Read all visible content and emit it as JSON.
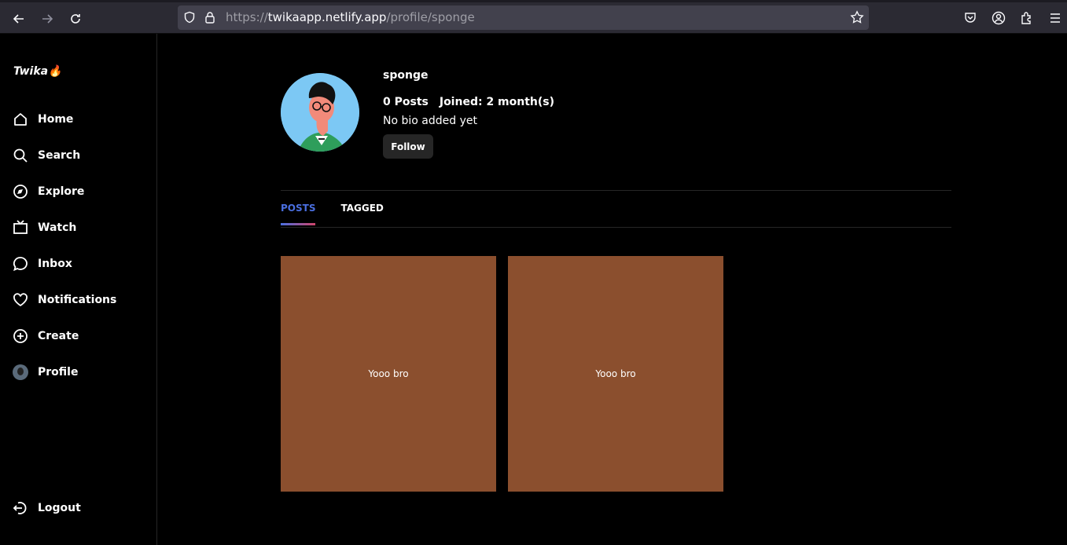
{
  "browser": {
    "url_protocol": "https://",
    "url_domain": "twikaapp.netlify.app",
    "url_path": "/profile/sponge"
  },
  "sidebar": {
    "logo": "Twika🔥",
    "items": [
      {
        "label": "Home",
        "icon": "home-icon"
      },
      {
        "label": "Search",
        "icon": "search-icon"
      },
      {
        "label": "Explore",
        "icon": "compass-icon"
      },
      {
        "label": "Watch",
        "icon": "tv-icon"
      },
      {
        "label": "Inbox",
        "icon": "chat-icon"
      },
      {
        "label": "Notifications",
        "icon": "heart-icon"
      },
      {
        "label": "Create",
        "icon": "plus-circle-icon"
      },
      {
        "label": "Profile",
        "icon": "avatar"
      }
    ],
    "logout": "Logout"
  },
  "profile": {
    "username": "sponge",
    "posts_count": "0 Posts",
    "joined": "Joined: 2 month(s)",
    "bio": "No bio added yet",
    "follow_label": "Follow"
  },
  "tabs": [
    {
      "label": "POSTS",
      "active": true
    },
    {
      "label": "TAGGED",
      "active": false
    }
  ],
  "posts": [
    {
      "text": "Yooo bro",
      "color": "#8b4f2e"
    },
    {
      "text": "Yooo bro",
      "color": "#8b4f2e"
    }
  ],
  "colors": {
    "accent": "#4a6fe0",
    "accent_end": "#d0456b",
    "post_bg": "#8b4f2e"
  }
}
